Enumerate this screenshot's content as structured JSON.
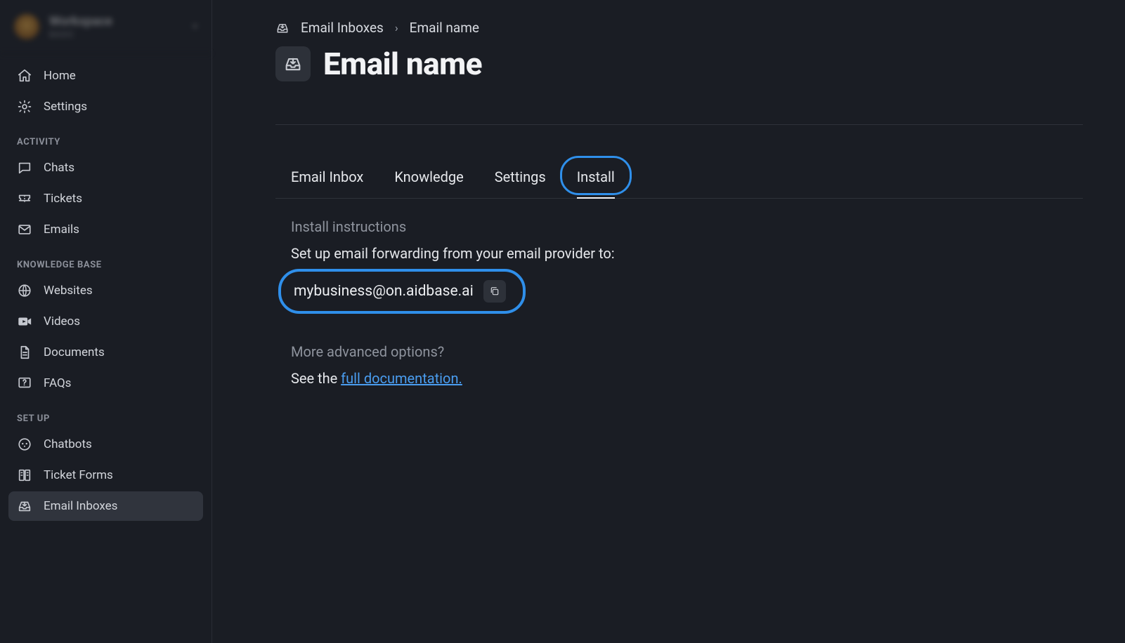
{
  "sidebar": {
    "workspace_name": "Workspace",
    "workspace_type": "BASIC",
    "nav_top": [
      {
        "label": "Home",
        "icon": "home"
      },
      {
        "label": "Settings",
        "icon": "gear"
      }
    ],
    "sections": [
      {
        "heading": "ACTIVITY",
        "items": [
          {
            "label": "Chats",
            "icon": "chat"
          },
          {
            "label": "Tickets",
            "icon": "ticket"
          },
          {
            "label": "Emails",
            "icon": "mail"
          }
        ]
      },
      {
        "heading": "KNOWLEDGE BASE",
        "items": [
          {
            "label": "Websites",
            "icon": "globe"
          },
          {
            "label": "Videos",
            "icon": "video"
          },
          {
            "label": "Documents",
            "icon": "document"
          },
          {
            "label": "FAQs",
            "icon": "faq"
          }
        ]
      },
      {
        "heading": "SET UP",
        "items": [
          {
            "label": "Chatbots",
            "icon": "bot"
          },
          {
            "label": "Ticket Forms",
            "icon": "form"
          },
          {
            "label": "Email Inboxes",
            "icon": "inbox",
            "active": true
          }
        ]
      }
    ]
  },
  "breadcrumb": {
    "root": "Email Inboxes",
    "current": "Email name"
  },
  "page": {
    "title": "Email name"
  },
  "tabs": [
    {
      "label": "Email Inbox"
    },
    {
      "label": "Knowledge"
    },
    {
      "label": "Settings"
    },
    {
      "label": "Install",
      "active": true
    }
  ],
  "install": {
    "heading": "Install instructions",
    "instruction": "Set up email forwarding from your email provider to:",
    "forward_email": "mybusiness@on.aidbase.ai",
    "advanced_heading": "More advanced options?",
    "advanced_prefix": "See the ",
    "advanced_link": "full documentation."
  }
}
